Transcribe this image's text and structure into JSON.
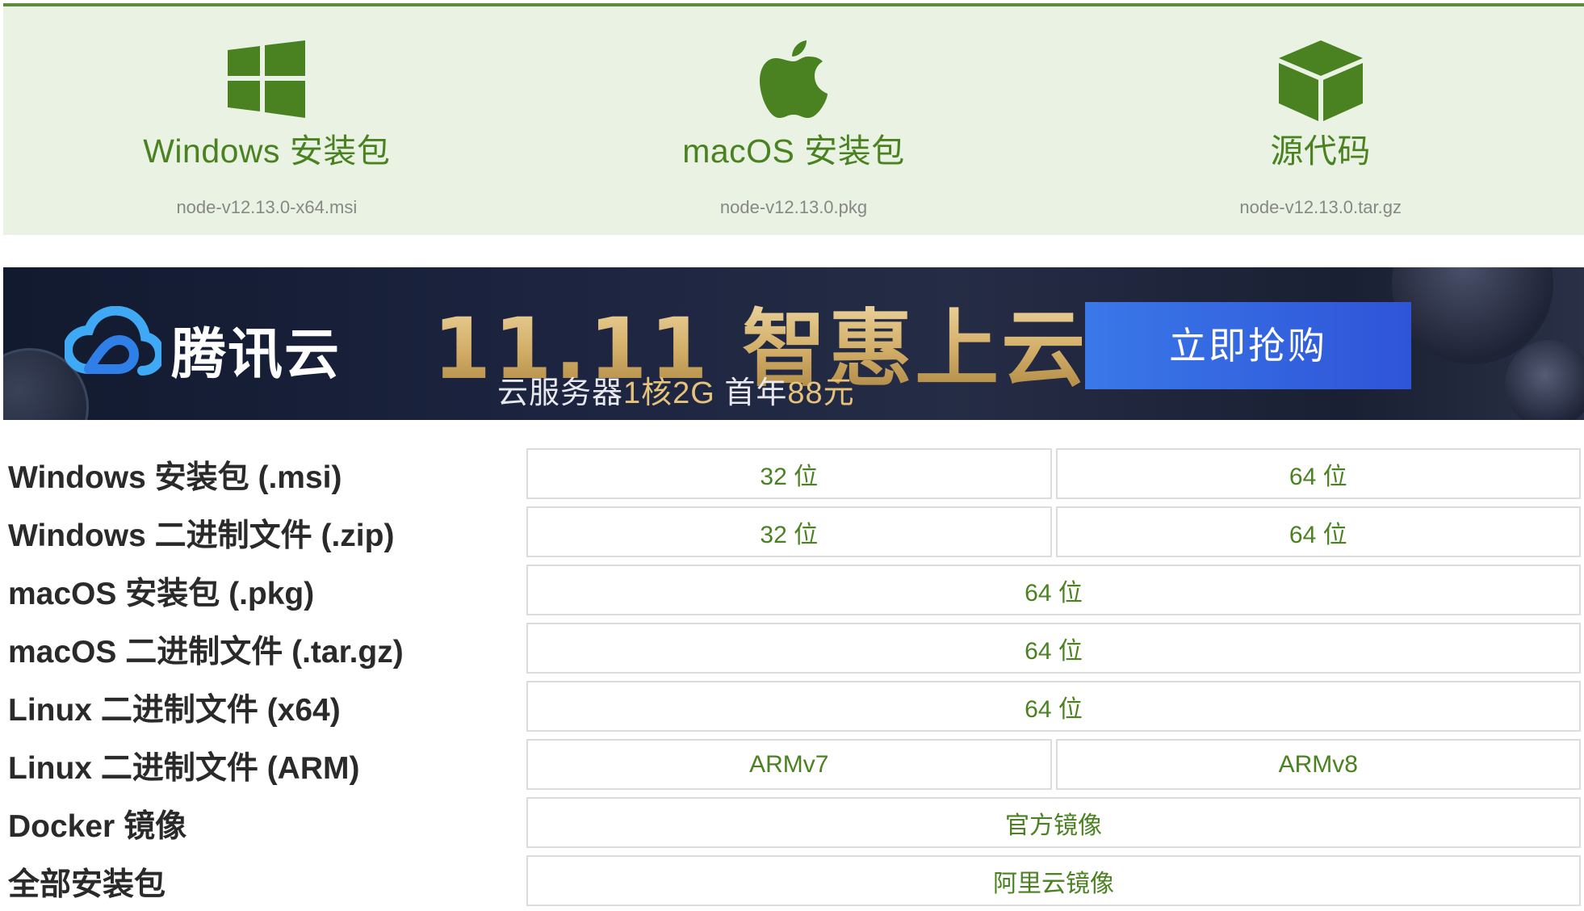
{
  "downloads": [
    {
      "icon": "windows-icon",
      "title": "Windows 安装包",
      "file": "node-v12.13.0-x64.msi"
    },
    {
      "icon": "apple-icon",
      "title": "macOS 安装包",
      "file": "node-v12.13.0.pkg"
    },
    {
      "icon": "source-box-icon",
      "title": "源代码",
      "file": "node-v12.13.0.tar.gz"
    }
  ],
  "banner": {
    "brand": "腾讯云",
    "headline": "11.11 智惠上云",
    "sub_prefix": "云服务器",
    "sub_spec": "1核2G",
    "sub_mid": " 首年",
    "sub_price": "88元",
    "cta": "立即抢购"
  },
  "table": {
    "rows": [
      {
        "label": "Windows 安装包 (.msi)",
        "links": [
          "32 位",
          "64 位"
        ]
      },
      {
        "label": "Windows 二进制文件 (.zip)",
        "links": [
          "32 位",
          "64 位"
        ]
      },
      {
        "label": "macOS 安装包 (.pkg)",
        "links": [
          "64 位"
        ]
      },
      {
        "label": "macOS 二进制文件 (.tar.gz)",
        "links": [
          "64 位"
        ]
      },
      {
        "label": "Linux 二进制文件 (x64)",
        "links": [
          "64 位"
        ]
      },
      {
        "label": "Linux 二进制文件 (ARM)",
        "links": [
          "ARMv7",
          "ARMv8"
        ]
      },
      {
        "label": "Docker 镜像",
        "links": [
          "官方镜像"
        ]
      },
      {
        "label": "全部安装包",
        "links": [
          "阿里云镜像"
        ]
      }
    ]
  },
  "colors": {
    "accent_green": "#4a8221",
    "card_bg": "#eaf3e3",
    "cta_blue": "#3a78e8"
  }
}
